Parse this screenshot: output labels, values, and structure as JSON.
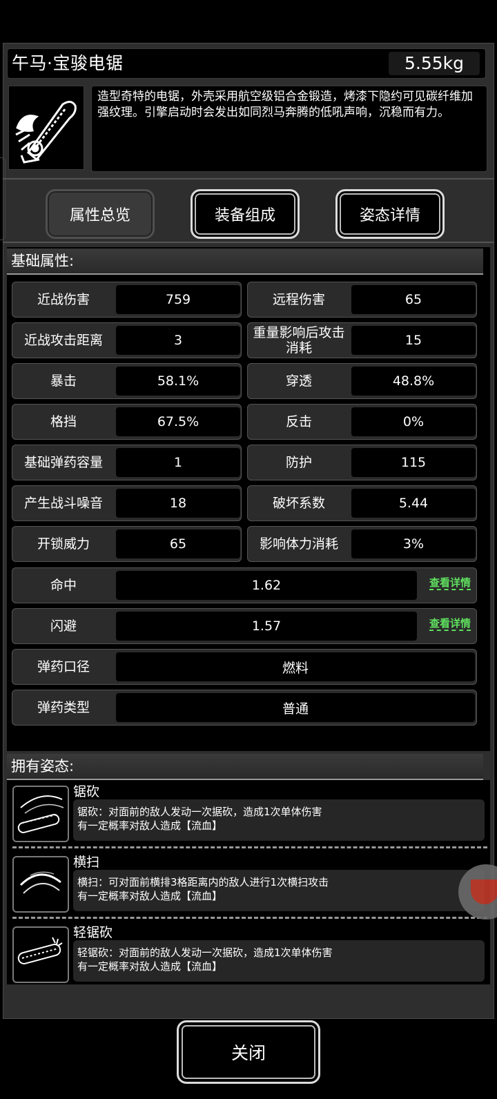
{
  "item": {
    "name": "午马·宝骏电锯",
    "weight": "5.55kg",
    "description": "造型奇特的电锯，外壳采用航空级铝合金锻造，烤漆下隐约可见碳纤维加强纹理。引擎启动时会发出如同烈马奔腾的低吼声响，沉稳而有力。",
    "icon": "chainsaw-horse-icon"
  },
  "tabs": [
    {
      "label": "属性总览"
    },
    {
      "label": "装备组成"
    },
    {
      "label": "姿态详情"
    }
  ],
  "basic": {
    "header": "基础属性:",
    "pairs": [
      {
        "l_label": "近战伤害",
        "l_value": "759",
        "r_label": "远程伤害",
        "r_value": "65"
      },
      {
        "l_label": "近战攻击距离",
        "l_value": "3",
        "r_label": "重量影响后攻击消耗",
        "r_value": "15"
      },
      {
        "l_label": "暴击",
        "l_value": "58.1%",
        "r_label": "穿透",
        "r_value": "48.8%"
      },
      {
        "l_label": "格挡",
        "l_value": "67.5%",
        "r_label": "反击",
        "r_value": "0%"
      },
      {
        "l_label": "基础弹药容量",
        "l_value": "1",
        "r_label": "防护",
        "r_value": "115"
      },
      {
        "l_label": "产生战斗噪音",
        "l_value": "18",
        "r_label": "破坏系数",
        "r_value": "5.44"
      },
      {
        "l_label": "开锁威力",
        "l_value": "65",
        "r_label": "影响体力消耗",
        "r_value": "3%"
      }
    ],
    "wide": [
      {
        "label": "命中",
        "value": "1.62",
        "link": "查看详情"
      },
      {
        "label": "闪避",
        "value": "1.57",
        "link": "查看详情"
      },
      {
        "label": "弹药口径",
        "value": "燃料"
      },
      {
        "label": "弹药类型",
        "value": "普通"
      }
    ]
  },
  "stances": {
    "header": "拥有姿态:",
    "items": [
      {
        "title": "锯砍",
        "line1": "锯砍：对面前的敌人发动一次据砍，造成1次单体伤害",
        "line2": "有一定概率对敌人造成【流血】",
        "icon": "saw-slash-icon"
      },
      {
        "title": "横扫",
        "line1": "横扫：可对面前横排3格距离内的敌人进行1次横扫攻击",
        "line2": "有一定概率对敌人造成【流血】",
        "icon": "sweep-icon"
      },
      {
        "title": "轻锯砍",
        "line1": "轻锯砍：对面前的敌人发动一次据砍，造成1次单体伤害",
        "line2": "有一定概率对敌人造成【流血】",
        "icon": "light-saw-icon"
      }
    ]
  },
  "close_label": "关闭",
  "colors": {
    "link": "#5fe05f",
    "float": "#c23a2a"
  }
}
